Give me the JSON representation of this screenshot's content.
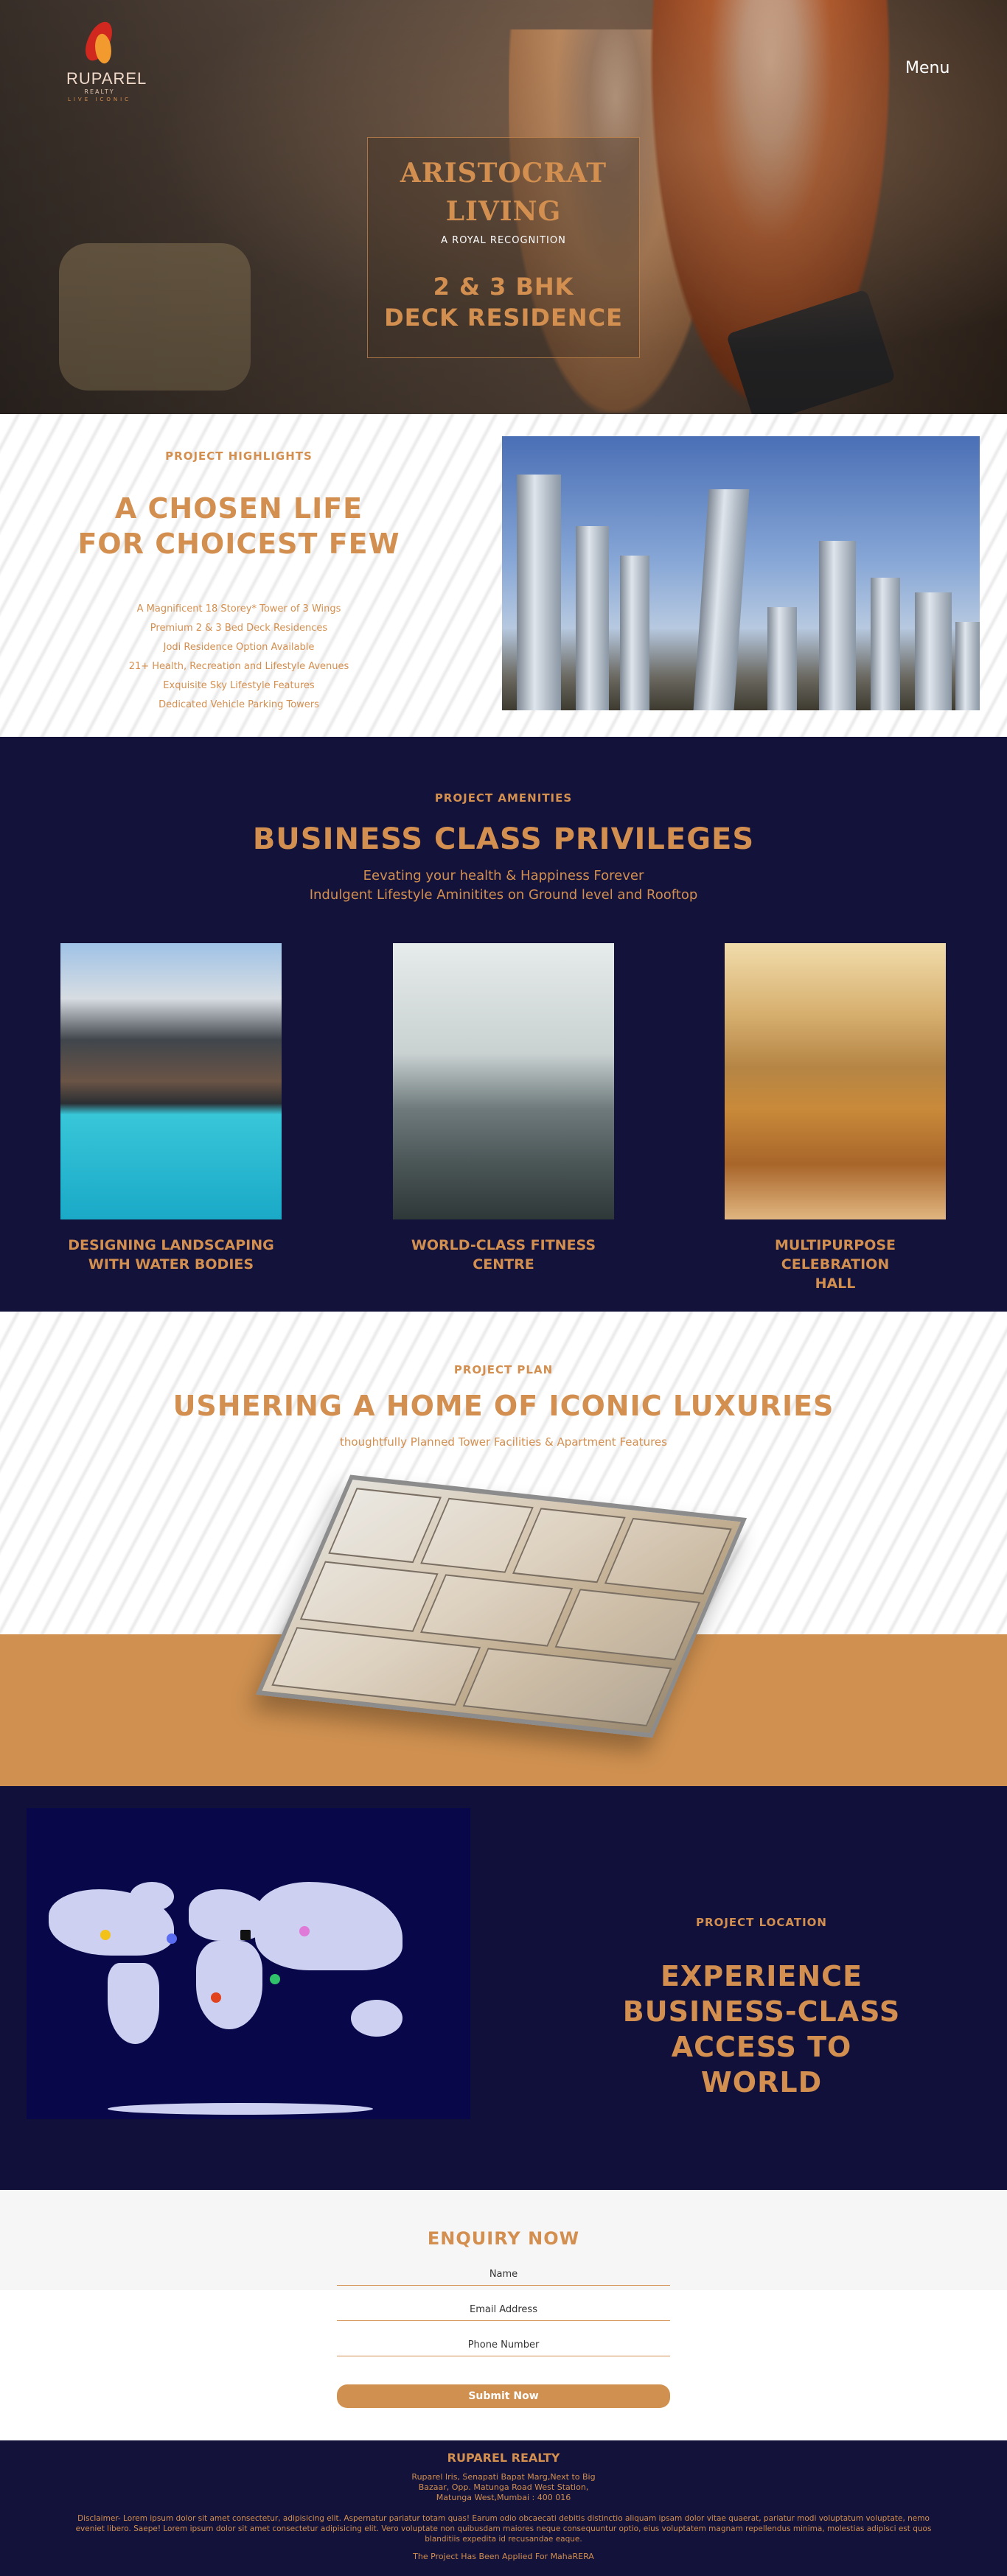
{
  "brand": {
    "name": "RUPAREL",
    "sub": "REALTY",
    "tagline": "LIVE ICONIC"
  },
  "header": {
    "menu_label": "Menu"
  },
  "hero": {
    "line1": "ARISTOCRAT",
    "line2": "LIVING",
    "subtitle": "A ROYAL RECOGNITION",
    "offer1": "2 & 3 BHK",
    "offer2": "DECK RESIDENCE"
  },
  "highlights": {
    "eyebrow": "PROJECT HIGHLIGHTS",
    "title1": "A CHOSEN LIFE",
    "title2": "FOR CHOICEST FEW",
    "items": [
      "A Magnificent 18 Storey* Tower of 3 Wings",
      "Premium 2 & 3 Bed Deck Residences",
      "Jodi Residence Option Available",
      "21+ Health, Recreation and Lifestyle Avenues",
      "Exquisite Sky Lifestyle Features",
      "Dedicated Vehicle Parking Towers"
    ]
  },
  "amenities": {
    "eyebrow": "PROJECT AMENITIES",
    "title": "BUSINESS CLASS PRIVILEGES",
    "sub1": "Eevating your health & Happiness Forever",
    "sub2": "Indulgent Lifestyle Aminitites on Ground level and Rooftop",
    "cards": [
      {
        "title1": "DESIGNING LANDSCAPING",
        "title2": "WITH WATER BODIES"
      },
      {
        "title1": "WORLD-CLASS FITNESS CENTRE",
        "title2": ""
      },
      {
        "title1": "MULTIPURPOSE CELEBRATION",
        "title2": "HALL"
      }
    ]
  },
  "plan": {
    "eyebrow": "PROJECT PLAN",
    "title": "USHERING A HOME OF ICONIC LUXURIES",
    "subtitle": "thoughtfully Planned Tower Facilities & Apartment Features"
  },
  "location": {
    "eyebrow": "PROJECT LOCATION",
    "line1": "EXPERIENCE",
    "line2": "BUSINESS-CLASS",
    "line3": "ACCESS TO",
    "line4": "WORLD"
  },
  "enquiry": {
    "title": "ENQUIRY NOW",
    "name_placeholder": "Name",
    "email_placeholder": "Email Address",
    "phone_placeholder": "Phone Number",
    "submit_label": "Submit Now"
  },
  "footer": {
    "title": "RUPAREL REALTY",
    "addr1": "Ruparel Iris, Senapati Bapat Marg,Next to Big",
    "addr2": "Bazaar, Opp. Matunga Road West Station,",
    "addr3": "Matunga West,Mumbai : 400 016",
    "disclaimer": "Disclaimer- Lorem ipsum dolor sit amet consectetur, adipisicing elit. Aspernatur pariatur totam quas! Earum odio obcaecati debitis distinctio aliquam ipsam dolor vitae quaerat, pariatur modi voluptatum voluptate, nemo eveniet libero. Saepe! Lorem ipsum dolor sit amet consectetur adipisicing elit. Vero voluptate non quibusdam maiores neque consequuntur optio, eius voluptatem magnam repellendus minima, molestias adipisci est quos blanditiis expedita id recusandae eaque.",
    "note": "The Project Has Been Applied For MahaRERA"
  },
  "colors": {
    "accent": "#d38f4f",
    "navy": "#12123a",
    "band": "#d09150"
  }
}
